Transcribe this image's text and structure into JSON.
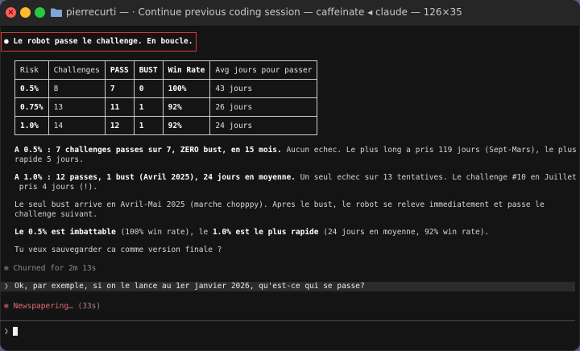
{
  "window": {
    "title": "pierrecurti — · Continue previous coding session — caffeinate ◂ claude — 126×35"
  },
  "terminal": {
    "user_message": "● Le robot passe le challenge. En boucle.",
    "table": {
      "headers": [
        "Risk",
        "Challenges",
        "PASS",
        "BUST",
        "Win Rate",
        "Avg jours pour passer"
      ],
      "rows": [
        [
          "0.5%",
          "8",
          "7",
          "0",
          "100%",
          "43 jours"
        ],
        [
          "0.75%",
          "13",
          "11",
          "1",
          "92%",
          "26 jours"
        ],
        [
          "1.0%",
          "14",
          "12",
          "1",
          "92%",
          "24 jours"
        ]
      ]
    },
    "para1_bold": "A 0.5% : 7 challenges passes sur 7, ZERO bust, en 15 mois.",
    "para1_rest": " Aucun echec. Le plus long a pris 119 jours (Sept-Mars), le plus",
    "para1_line2": "rapide 5 jours.",
    "para2_bold": "A 1.0% : 12 passes, 1 bust (Avril 2025), 24 jours en moyenne.",
    "para2_rest": " Un seul echec sur 13 tentatives. Le challenge #10 en Juillet a",
    "para2_line2": " pris 4 jours (!).",
    "para3_line1": "Le seul bust arrive en Avril-Mai 2025 (marche chopppy). Apres le bust, le robot se releve immediatement et passe le",
    "para3_line2": "challenge suivant.",
    "para4_b1": "Le 0.5% est imbattable",
    "para4_t1": " (100% win rate), le ",
    "para4_b2": "1.0% est le plus rapide",
    "para4_t2": " (24 jours en moyenne, 92% win rate).",
    "question": "Tu veux sauvegarder ca comme version finale ?",
    "churned": "✻ Churned for 2m 13s",
    "prompt_chevron": "❯",
    "prompt_text": "Ok, par exemple, si on le lance au 1er janvier 2026, qu'est-ce qui se passe?",
    "status_label": "✻ Newspapering…",
    "status_time": " (33s)",
    "input_chevron": "❯"
  },
  "colors": {
    "highlight_border": "#d83a32",
    "status_text": "#e06c75",
    "background": "#141414"
  }
}
